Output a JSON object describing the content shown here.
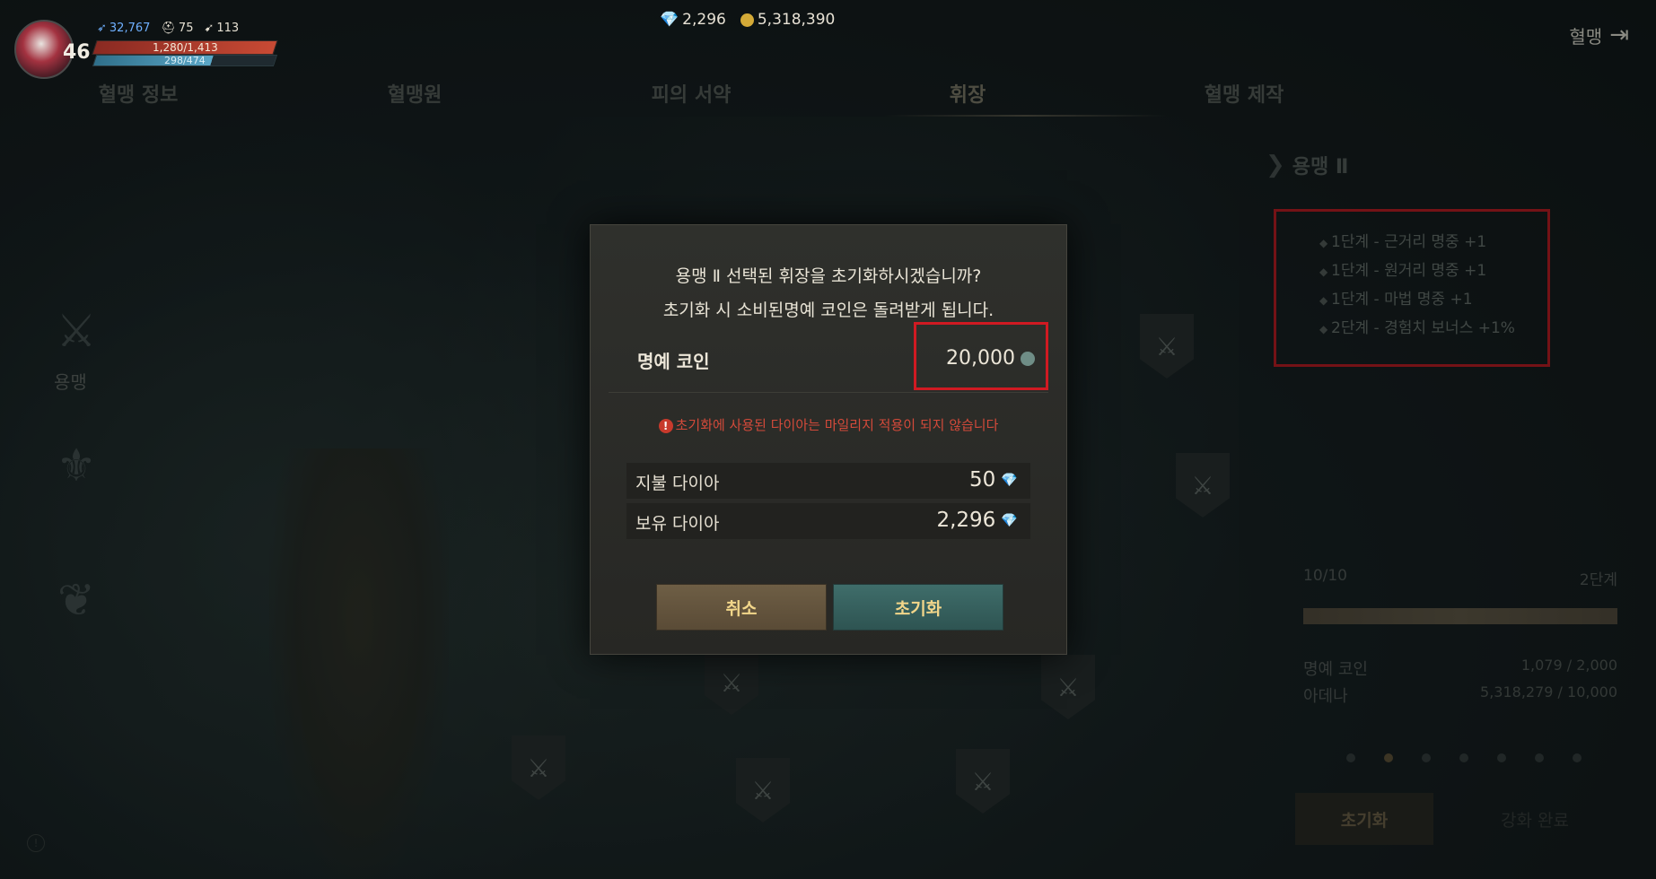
{
  "hud": {
    "level": "46",
    "power": "32,767",
    "defense": "75",
    "weight": "113",
    "hp": "1,280/1,413",
    "mp": "298/474"
  },
  "currency": {
    "diamonds": "2,296",
    "adena": "5,318,390"
  },
  "clan_button": {
    "label": "혈맹"
  },
  "tabs": [
    "혈맹 정보",
    "혈맹원",
    "피의 서약",
    "휘장",
    "혈맹 제작"
  ],
  "active_tab": "휘장",
  "left_panel": {
    "selected_label": "용맹"
  },
  "right_panel": {
    "title": "용맹 Ⅱ",
    "effects": [
      "1단계 - 근거리 명중 +1",
      "1단계 - 원거리 명중 +1",
      "1단계 - 마법 명중 +1",
      "2단계 - 경험치 보너스 +1%"
    ],
    "progress_text": "10/10",
    "stage_text": "2단계",
    "progress": 1.0,
    "requirements": [
      {
        "label": "명예 코인",
        "value": "1,079 / 2,000"
      },
      {
        "label": "아데나",
        "value": "5,318,279 / 10,000"
      }
    ],
    "reset_label": "초기화",
    "done_label": "강화 완료"
  },
  "dialog": {
    "line1": "용맹 Ⅱ 선택된 휘장을 초기화하시겠습니까?",
    "line2": "초기화 시 소비된명예 코인은 돌려받게 됩니다.",
    "honor_label": "명예 코인",
    "honor_value": "20,000",
    "warning": "초기화에 사용된 다이아는 마일리지 적용이 되지 않습니다",
    "pay_label": "지불 다이아",
    "pay_value": "50",
    "own_label": "보유 다이아",
    "own_value": "2,296",
    "cancel_label": "취소",
    "confirm_label": "초기화"
  },
  "colors": {
    "highlight": "#d01a22",
    "gold_text": "#f2d68a",
    "warning": "#d34a3a"
  }
}
